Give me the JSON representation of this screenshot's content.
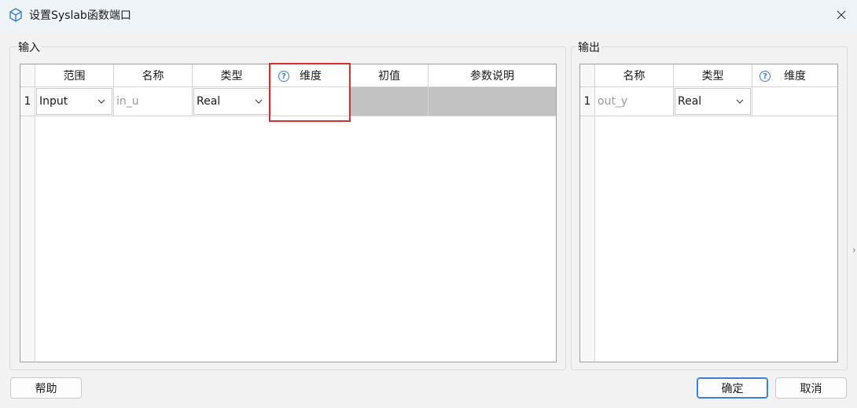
{
  "window": {
    "title": "设置Syslab函数端口",
    "close_glyph": "✕"
  },
  "input_group": {
    "label": "输入",
    "columns": [
      "范围",
      "名称",
      "类型",
      "维度",
      "初值",
      "参数说明"
    ],
    "help_glyph": "?",
    "rows": [
      {
        "index": "1",
        "scope": "Input",
        "name": "in_u",
        "type": "Real",
        "dimension": "",
        "initial": "",
        "description": ""
      }
    ]
  },
  "output_group": {
    "label": "输出",
    "columns": [
      "名称",
      "类型",
      "维度"
    ],
    "help_glyph": "?",
    "rows": [
      {
        "index": "1",
        "name": "out_y",
        "type": "Real",
        "dimension": ""
      }
    ]
  },
  "buttons": {
    "help": "帮助",
    "ok": "确定",
    "cancel": "取消"
  },
  "colors": {
    "highlight": "#d43030",
    "accent": "#3d7fd6",
    "disabled_cell": "#c2c2c2"
  }
}
